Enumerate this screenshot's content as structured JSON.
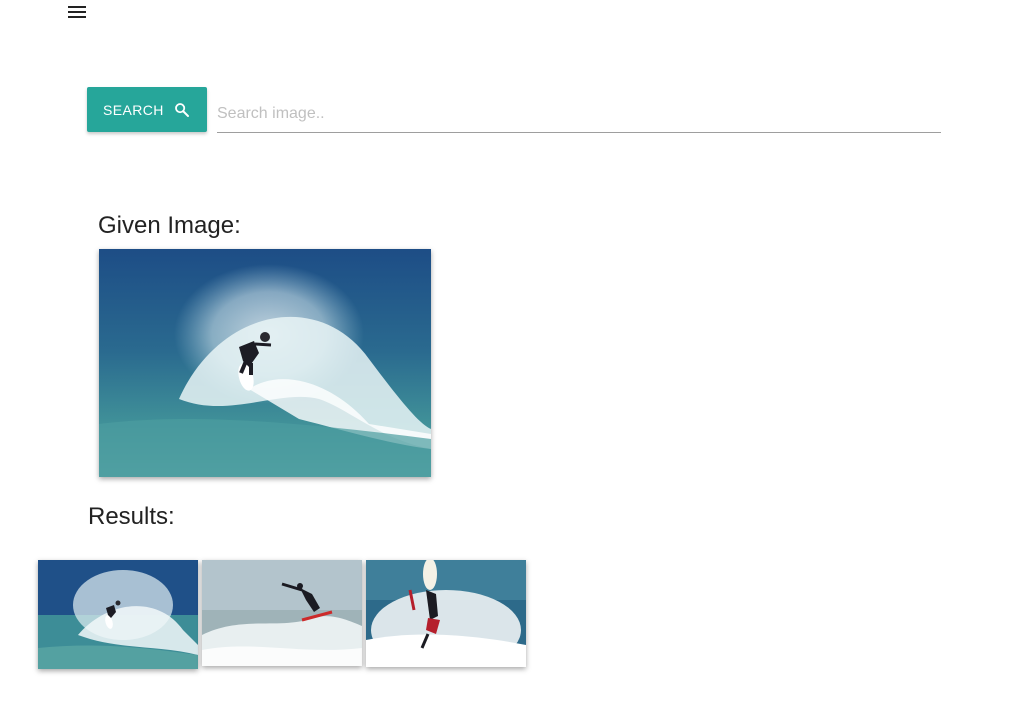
{
  "header": {
    "menu_icon": "menu-icon"
  },
  "search": {
    "button_label": "SEARCH",
    "button_icon": "search-icon",
    "placeholder": "Search image..",
    "value": ""
  },
  "given": {
    "label": "Given Image:"
  },
  "results": {
    "label": "Results:",
    "count": 3
  },
  "colors": {
    "accent": "#26a69a",
    "ocean_dark": "#1f4f86",
    "foam": "#eef3f4"
  }
}
